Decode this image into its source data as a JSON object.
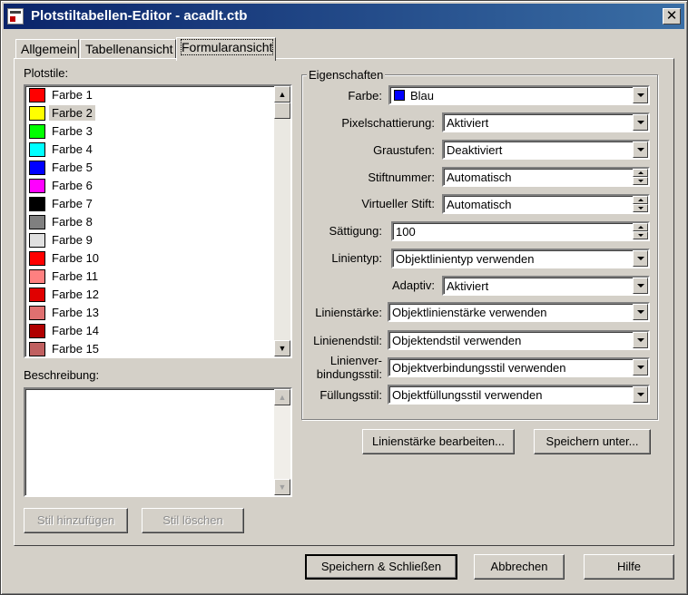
{
  "window": {
    "title": "Plotstiltabellen-Editor - acadlt.ctb",
    "close_label": "✕"
  },
  "tabs": [
    {
      "label": "Allgemein"
    },
    {
      "label": "Tabellenansicht"
    },
    {
      "label": "Formularansicht"
    }
  ],
  "styles_panel": {
    "label": "Plotstile:",
    "items": [
      {
        "label": "Farbe 1",
        "color": "#ff0000"
      },
      {
        "label": "Farbe 2",
        "color": "#ffff00"
      },
      {
        "label": "Farbe 3",
        "color": "#00ff00"
      },
      {
        "label": "Farbe 4",
        "color": "#00ffff"
      },
      {
        "label": "Farbe 5",
        "color": "#0000ff"
      },
      {
        "label": "Farbe 6",
        "color": "#ff00ff"
      },
      {
        "label": "Farbe 7",
        "color": "#000000"
      },
      {
        "label": "Farbe 8",
        "color": "#808080"
      },
      {
        "label": "Farbe 9",
        "color": "#e0e0e0"
      },
      {
        "label": "Farbe 10",
        "color": "#ff0000"
      },
      {
        "label": "Farbe 11",
        "color": "#ff8080"
      },
      {
        "label": "Farbe 12",
        "color": "#e00000"
      },
      {
        "label": "Farbe 13",
        "color": "#e07070"
      },
      {
        "label": "Farbe 14",
        "color": "#b00000"
      },
      {
        "label": "Farbe 15",
        "color": "#c06060"
      }
    ],
    "selected_index": 1
  },
  "description": {
    "label": "Beschreibung:",
    "value": ""
  },
  "buttons": {
    "add_style": "Stil hinzufügen",
    "delete_style": "Stil löschen",
    "edit_lineweights": "Linienstärke bearbeiten...",
    "save_as": "Speichern unter...",
    "save_close": "Speichern & Schließen",
    "cancel": "Abbrechen",
    "help": "Hilfe"
  },
  "properties": {
    "group_title": "Eigenschaften",
    "color": {
      "label": "Farbe:",
      "value": "Blau",
      "swatch": "#0000ff"
    },
    "dithering": {
      "label": "Pixelschattierung:",
      "value": "Aktiviert"
    },
    "grayscale": {
      "label": "Graustufen:",
      "value": "Deaktiviert"
    },
    "pen_number": {
      "label": "Stiftnummer:",
      "value": "Automatisch"
    },
    "virtual_pen": {
      "label": "Virtueller Stift:",
      "value": "Automatisch"
    },
    "screening": {
      "label": "Sättigung:",
      "value": "100"
    },
    "linetype": {
      "label": "Linientyp:",
      "value": "Objektlinientyp verwenden"
    },
    "adaptive": {
      "label": "Adaptiv:",
      "value": "Aktiviert"
    },
    "lineweight": {
      "label": "Linienstärke:",
      "value": "Objektlinienstärke verwenden"
    },
    "line_end": {
      "label": "Linienendstil:",
      "value": "Objektendstil verwenden"
    },
    "line_join": {
      "label_line1": "Linienver-",
      "label_line2": "bindungsstil:",
      "value": "Objektverbindungsstil verwenden"
    },
    "fill": {
      "label": "Füllungsstil:",
      "value": "Objektfüllungsstil verwenden"
    }
  }
}
